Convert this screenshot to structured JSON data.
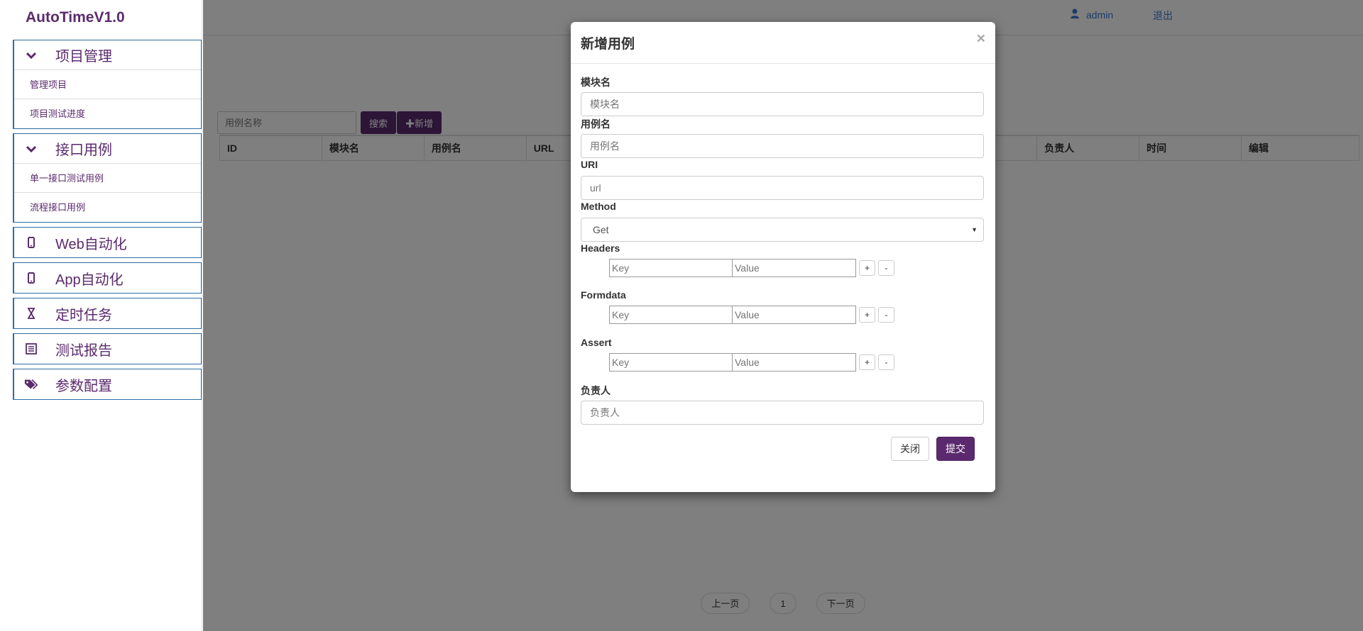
{
  "app": {
    "title": "AutoTimeV1.0"
  },
  "sidebar": {
    "groups": [
      {
        "label": "项目管理",
        "icon": "chevron-down-icon",
        "items": [
          "管理项目",
          "项目测试进度"
        ]
      },
      {
        "label": "接口用例",
        "icon": "chevron-down-icon",
        "items": [
          "单一接口测试用例",
          "流程接口用例"
        ]
      },
      {
        "label": "Web自动化",
        "icon": "mobile-icon"
      },
      {
        "label": "App自动化",
        "icon": "mobile-icon"
      },
      {
        "label": "定时任务",
        "icon": "hourglass-icon"
      },
      {
        "label": "测试报告",
        "icon": "list-alt-icon"
      },
      {
        "label": "参数配置",
        "icon": "tags-icon"
      }
    ]
  },
  "header": {
    "user": "admin",
    "logout": "退出"
  },
  "toolbar": {
    "search_placeholder": "用例名称",
    "search_label": "搜索",
    "add_label": "新增"
  },
  "table": {
    "columns": [
      "ID",
      "模块名",
      "用例名",
      "URL",
      "",
      "",
      "",
      "",
      "负责人",
      "时间",
      "编辑"
    ]
  },
  "pager": {
    "prev": "上一页",
    "page": "1",
    "next": "下一页"
  },
  "modal": {
    "title": "新增用例",
    "close_symbol": "×",
    "fields": {
      "module": {
        "label": "模块名",
        "placeholder": "模块名"
      },
      "case": {
        "label": "用例名",
        "placeholder": "用例名"
      },
      "uri": {
        "label": "URI",
        "placeholder": "url"
      },
      "method": {
        "label": "Method",
        "value": "Get"
      },
      "headers": {
        "label": "Headers"
      },
      "formdata": {
        "label": "Formdata"
      },
      "assert": {
        "label": "Assert"
      },
      "owner": {
        "label": "负责人",
        "placeholder": "负责人"
      }
    },
    "kv": {
      "key_placeholder": "Key",
      "value_placeholder": "Value",
      "add": "+",
      "remove": "-"
    },
    "buttons": {
      "close": "关闭",
      "submit": "提交"
    }
  },
  "colors": {
    "brand": "#5b2a6e",
    "link": "#3a7bd5",
    "border": "#2e6da4"
  }
}
